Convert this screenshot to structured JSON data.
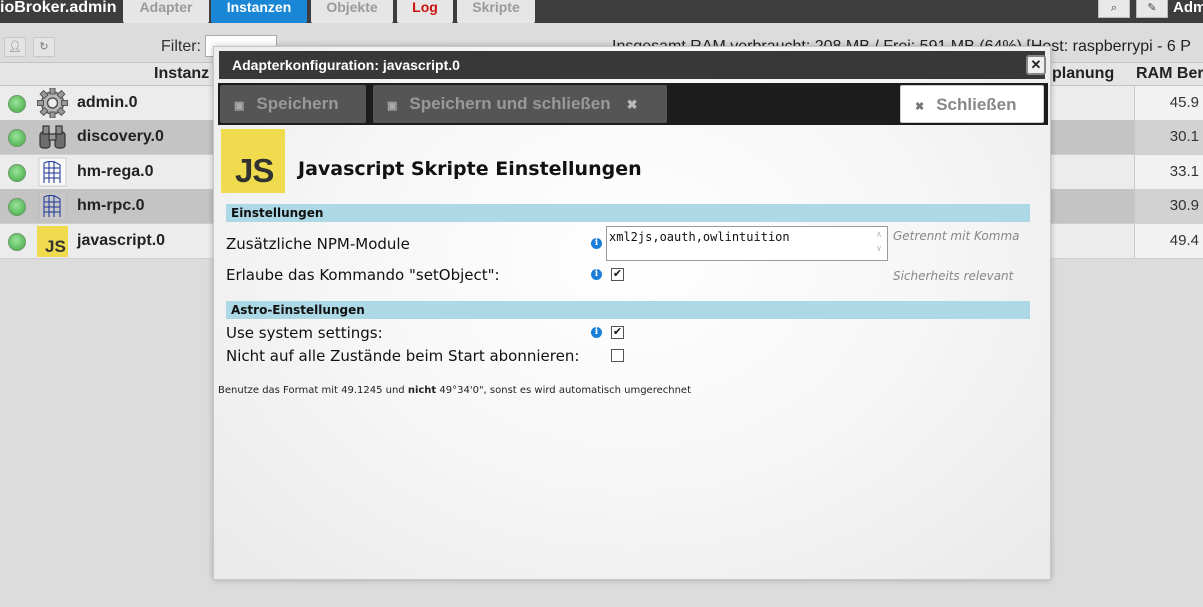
{
  "app": {
    "title": "ioBroker.admin",
    "user": "Adm"
  },
  "tabs": [
    {
      "label": "Adapter"
    },
    {
      "label": "Instanzen"
    },
    {
      "label": "Objekte"
    },
    {
      "label": "Log"
    },
    {
      "label": "Skripte"
    }
  ],
  "toolbar": {
    "filter_label": "Filter:",
    "filter_value": "",
    "ram_text": "Insgesamt RAM verbraucht: 208 MB / Frei: 591 MB (64%) [Host: raspberrypi - 6 P"
  },
  "table": {
    "headers": {
      "instanz": "Instanz",
      "planung": "planung",
      "ram": "RAM Ber"
    },
    "rows": [
      {
        "name": "admin.0",
        "ram": "45.9",
        "icon": "gear-icon"
      },
      {
        "name": "discovery.0",
        "ram": "30.1",
        "icon": "binoculars-icon"
      },
      {
        "name": "hm-rega.0",
        "ram": "33.1",
        "icon": "homematic-icon"
      },
      {
        "name": "hm-rpc.0",
        "ram": "30.9",
        "icon": "homematic-icon"
      },
      {
        "name": "javascript.0",
        "ram": "49.4",
        "icon": "javascript-icon"
      }
    ]
  },
  "modal": {
    "title": "Adapterkonfiguration: javascript.0",
    "close_glyph": "✕",
    "buttons": {
      "save": "Speichern",
      "save_close": "Speichern und schließen",
      "close": "Schließen"
    },
    "logo_text": "JS",
    "heading": "Javascript Skripte Einstellungen",
    "sections": {
      "settings": "Einstellungen",
      "astro": "Astro-Einstellungen"
    },
    "options": {
      "npm_label": "Zusätzliche NPM-Module",
      "npm_value": "xml2js,oauth,owlintuition",
      "npm_hint": "Getrennt mit Komma",
      "setobject_label": "Erlaube das Kommando \"setObject\":",
      "setobject_checked": true,
      "setobject_hint": "Sicherheits relevant",
      "system_label": "Use system settings:",
      "system_checked": true,
      "subscribe_label": "Nicht auf alle Zustände beim Start abonnieren:",
      "subscribe_checked": false
    },
    "footer_note": {
      "part1": "Benutze das Format mit 49.1245 und ",
      "bold": "nicht",
      "part2": " 49°34'0\", sonst es wird automatisch umgerechnet"
    }
  },
  "colors": {
    "active_tab": "#1a87d6",
    "log_tab": "#cc1111",
    "section_bar": "#add8e6",
    "js_yellow": "#f0db4f"
  }
}
